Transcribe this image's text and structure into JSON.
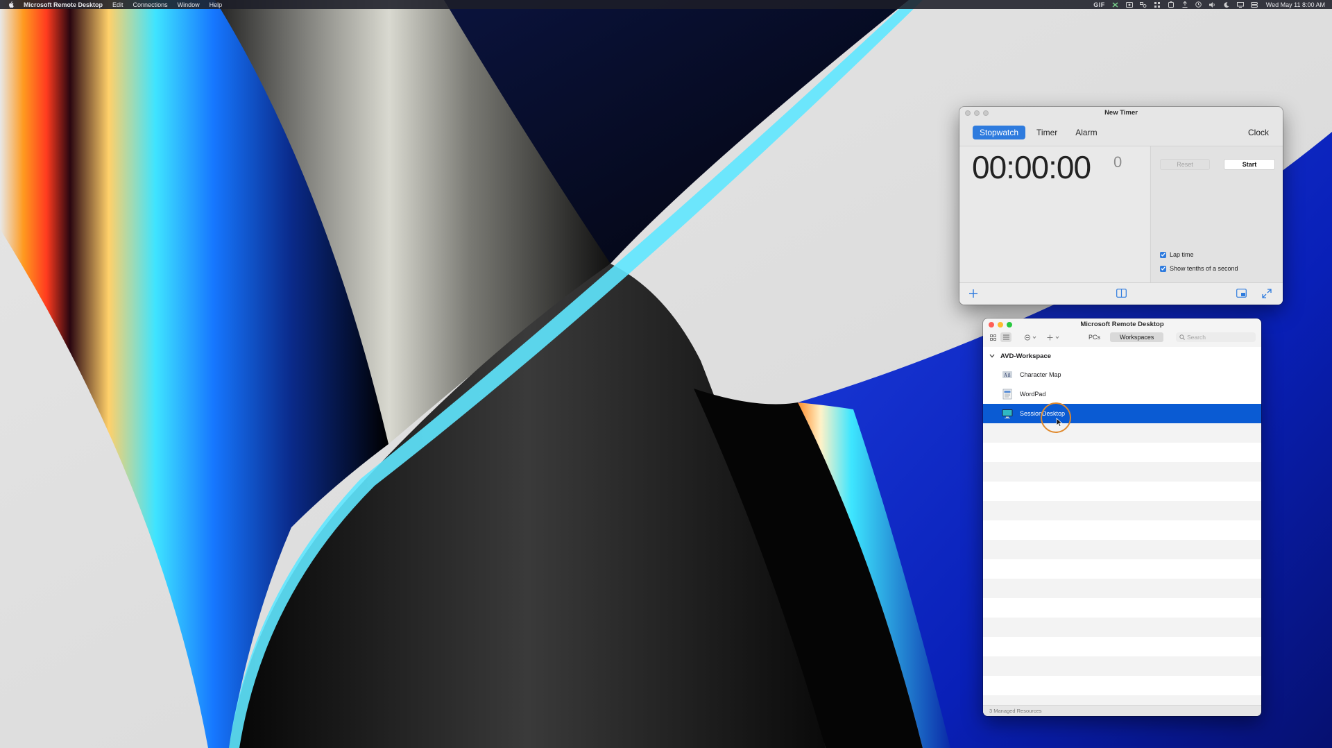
{
  "menubar": {
    "app_name": "Microsoft Remote Desktop",
    "items": [
      "Edit",
      "Connections",
      "Window",
      "Help"
    ],
    "status_gif": "GIF",
    "clock": "Wed May 11  8:00 AM"
  },
  "timer_window": {
    "title": "New Timer",
    "tabs": [
      "Stopwatch",
      "Timer",
      "Alarm"
    ],
    "active_tab": "Stopwatch",
    "clock_tab": "Clock",
    "time": "00:00:00",
    "tenths": "0",
    "reset_label": "Reset",
    "start_label": "Start",
    "lap_time_label": "Lap time",
    "show_tenths_label": "Show tenths of a second",
    "lap_time_checked": true,
    "show_tenths_checked": true
  },
  "rdp_window": {
    "title": "Microsoft Remote Desktop",
    "segments": [
      "PCs",
      "Workspaces"
    ],
    "active_segment": "Workspaces",
    "search_placeholder": "Search",
    "group_name": "AVD-Workspace",
    "resources": [
      {
        "name": "Character Map",
        "icon": "character-map-icon",
        "selected": false
      },
      {
        "name": "WordPad",
        "icon": "wordpad-icon",
        "selected": false
      },
      {
        "name": "SessionDesktop",
        "icon": "desktop-monitor-icon",
        "selected": true
      }
    ],
    "status": "3 Managed Resources"
  },
  "colors": {
    "accent": "#2e7bde",
    "selection": "#0a5bd3",
    "cursor_ring": "#e08a2e"
  }
}
